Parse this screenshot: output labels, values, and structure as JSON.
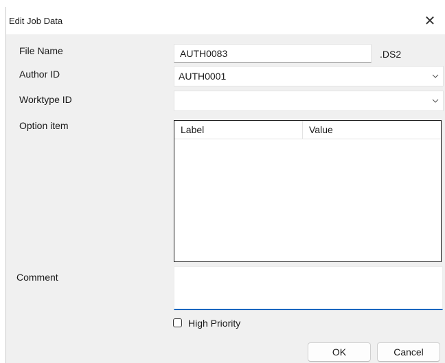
{
  "dialog": {
    "title": "Edit Job Data",
    "close_glyph": "✕"
  },
  "fields": {
    "file_name_label": "File Name",
    "file_name_value": "AUTH0083",
    "file_extension": ".DS2",
    "author_id_label": "Author ID",
    "author_id_value": "AUTH0001",
    "worktype_id_label": "Worktype ID",
    "worktype_id_value": "",
    "option_item_label": "Option item",
    "comment_label": "Comment",
    "comment_value": ""
  },
  "option_table": {
    "columns": [
      "Label",
      "Value"
    ],
    "rows": []
  },
  "high_priority": {
    "label": "High Priority",
    "checked": false
  },
  "buttons": {
    "ok": "OK",
    "cancel": "Cancel"
  },
  "icons": {
    "close": "close-icon",
    "dropdown": "chevron-down-icon"
  }
}
